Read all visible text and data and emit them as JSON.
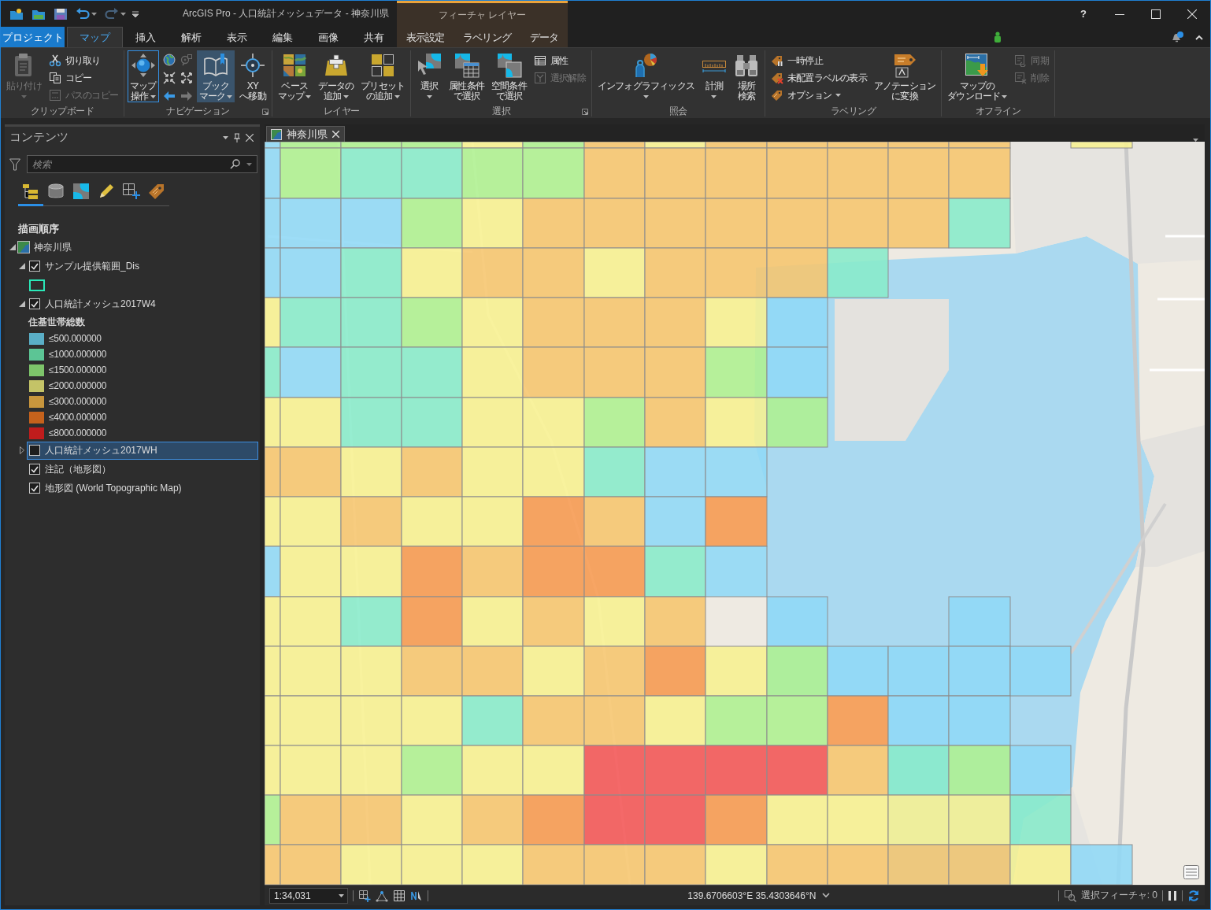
{
  "window": {
    "title": "ArcGIS Pro - 人口統計メッシュデータ - 神奈川県",
    "contextual_header": "フィーチャ レイヤー",
    "help": "?"
  },
  "quick_access": [
    {
      "dropdown": false,
      "disabled": false
    },
    {
      "dropdown": false,
      "disabled": false
    },
    {
      "dropdown": false,
      "disabled": false
    },
    {
      "dropdown": true,
      "disabled": false
    },
    {
      "dropdown": true,
      "disabled": true
    }
  ],
  "tabs": [
    {
      "label": "プロジェクト",
      "kind": "backstage",
      "selected": false
    },
    {
      "label": "マップ",
      "kind": "core",
      "selected": true
    },
    {
      "label": "挿入",
      "kind": "core",
      "selected": false
    },
    {
      "label": "解析",
      "kind": "core",
      "selected": false
    },
    {
      "label": "表示",
      "kind": "core",
      "selected": false
    },
    {
      "label": "編集",
      "kind": "core",
      "selected": false
    },
    {
      "label": "画像",
      "kind": "core",
      "selected": false
    },
    {
      "label": "共有",
      "kind": "core",
      "selected": false
    },
    {
      "label": "表示設定",
      "kind": "contextual",
      "selected": false
    },
    {
      "label": "ラベリング",
      "kind": "contextual",
      "selected": false
    },
    {
      "label": "データ",
      "kind": "contextual",
      "selected": false
    }
  ],
  "notifications": {
    "unread": true
  },
  "ribbon": {
    "groups": [
      {
        "label": "クリップボード",
        "launcher": false,
        "items": [
          {
            "kind": "large",
            "lines": [
              "貼り付け"
            ],
            "dropdown": true,
            "disabled": true,
            "active": false,
            "highlighted": false
          },
          {
            "kind": "stack",
            "items": [
              {
                "label": "切り取り",
                "disabled": false,
                "dropdown": false
              },
              {
                "label": "コピー",
                "disabled": false,
                "dropdown": false
              },
              {
                "label": "パスのコピー",
                "disabled": true,
                "dropdown": false
              }
            ]
          }
        ]
      },
      {
        "label": "ナビゲーション",
        "launcher": true,
        "items": [
          {
            "kind": "large",
            "lines": [
              "マップ",
              "操作"
            ],
            "dropdown": true,
            "disabled": false,
            "active": true,
            "highlighted": false
          },
          {
            "kind": "tools",
            "tools": [
              {
                "disabled": false
              },
              {
                "disabled": true
              },
              {
                "disabled": false
              },
              {
                "disabled": false
              },
              {
                "disabled": false
              },
              {
                "disabled": true
              }
            ]
          },
          {
            "kind": "large",
            "lines": [
              "ブック",
              "マーク"
            ],
            "dropdown": true,
            "disabled": false,
            "active": false,
            "highlighted": true
          },
          {
            "kind": "large",
            "lines": [
              "XY",
              "へ移動"
            ],
            "dropdown": false,
            "disabled": false,
            "active": false,
            "highlighted": false
          }
        ]
      },
      {
        "label": "レイヤー",
        "launcher": false,
        "items": [
          {
            "kind": "large",
            "lines": [
              "ベース",
              "マップ"
            ],
            "dropdown": true,
            "disabled": false,
            "active": false,
            "highlighted": false
          },
          {
            "kind": "large",
            "lines": [
              "データの",
              "追加"
            ],
            "dropdown": true,
            "disabled": false,
            "active": false,
            "highlighted": false
          },
          {
            "kind": "large",
            "lines": [
              "プリセット",
              "の追加"
            ],
            "dropdown": true,
            "disabled": false,
            "active": false,
            "highlighted": false
          }
        ]
      },
      {
        "label": "選択",
        "launcher": true,
        "items": [
          {
            "kind": "large",
            "lines": [
              "選択"
            ],
            "dropdown": true,
            "disabled": false,
            "active": false,
            "highlighted": false
          },
          {
            "kind": "large",
            "lines": [
              "属性条件",
              "で選択"
            ],
            "dropdown": false,
            "disabled": false,
            "active": false,
            "highlighted": false
          },
          {
            "kind": "large",
            "lines": [
              "空間条件",
              "で選択"
            ],
            "dropdown": false,
            "disabled": false,
            "active": false,
            "highlighted": false
          },
          {
            "kind": "stack",
            "items": [
              {
                "label": "属性",
                "disabled": false,
                "dropdown": false
              },
              {
                "label": "選択解除",
                "disabled": true,
                "dropdown": false
              }
            ]
          }
        ]
      },
      {
        "label": "照会",
        "launcher": false,
        "items": [
          {
            "kind": "large",
            "lines": [
              "インフォグラフィックス"
            ],
            "dropdown": true,
            "disabled": false,
            "active": false,
            "highlighted": false
          },
          {
            "kind": "large",
            "lines": [
              "計測"
            ],
            "dropdown": true,
            "disabled": false,
            "active": false,
            "highlighted": false
          },
          {
            "kind": "large",
            "lines": [
              "場所",
              "検索"
            ],
            "dropdown": false,
            "disabled": false,
            "active": false,
            "highlighted": false
          }
        ]
      },
      {
        "label": "ラベリング",
        "launcher": false,
        "items": [
          {
            "kind": "stack",
            "items": [
              {
                "label": "一時停止",
                "disabled": false,
                "dropdown": false
              },
              {
                "label": "未配置ラベルの表示",
                "disabled": false,
                "dropdown": false
              },
              {
                "label": "オプション",
                "disabled": false,
                "dropdown": true
              }
            ]
          },
          {
            "kind": "large",
            "lines": [
              "アノテーション",
              "に変換"
            ],
            "dropdown": false,
            "disabled": false,
            "active": false,
            "highlighted": false
          }
        ]
      },
      {
        "label": "オフライン",
        "launcher": false,
        "items": [
          {
            "kind": "large",
            "lines": [
              "マップの",
              "ダウンロード"
            ],
            "dropdown": true,
            "disabled": false,
            "active": false,
            "highlighted": false
          },
          {
            "kind": "stack",
            "items": [
              {
                "label": "同期",
                "disabled": true,
                "dropdown": false
              },
              {
                "label": "削除",
                "disabled": true,
                "dropdown": false
              }
            ]
          }
        ]
      }
    ]
  },
  "contents": {
    "title": "コンテンツ",
    "search": {
      "placeholder": "検索"
    },
    "views": [
      {
        "selected": true
      },
      {
        "selected": false
      },
      {
        "selected": false
      },
      {
        "selected": false
      },
      {
        "selected": false
      },
      {
        "selected": false
      }
    ],
    "heading": "描画順序",
    "tree": {
      "label": "神奈川県",
      "expanded": true,
      "children": [
        {
          "label": "サンプル提供範囲_Dis",
          "kind": "layer",
          "checked": true,
          "expanded": true,
          "selected": false,
          "legend": {
            "classes": [
              {
                "kind": "outline",
                "color": "#2ae8b8"
              }
            ]
          }
        },
        {
          "label": "人口統計メッシュ2017W4",
          "kind": "layer",
          "checked": true,
          "expanded": true,
          "selected": false,
          "legend": {
            "title": "住基世帯総数",
            "classes": [
              {
                "kind": "fill",
                "label": "≤500.000000",
                "color": "#5aaec6"
              },
              {
                "kind": "fill",
                "label": "≤1000.000000",
                "color": "#5cc595"
              },
              {
                "kind": "fill",
                "label": "≤1500.000000",
                "color": "#7dc46a"
              },
              {
                "kind": "fill",
                "label": "≤2000.000000",
                "color": "#c4c367"
              },
              {
                "kind": "fill",
                "label": "≤3000.000000",
                "color": "#c8963d"
              },
              {
                "kind": "fill",
                "label": "≤4000.000000",
                "color": "#c5621c"
              },
              {
                "kind": "fill",
                "label": "≤8000.000000",
                "color": "#c01c1c"
              }
            ]
          }
        },
        {
          "label": "人口統計メッシュ2017WH",
          "kind": "layer",
          "checked": false,
          "expanded": false,
          "selected": true
        },
        {
          "label": "注記（地形図）",
          "kind": "basemap",
          "checked": true,
          "selected": false
        },
        {
          "label": "地形図 (World Topographic Map)",
          "kind": "basemap",
          "checked": true,
          "selected": false
        }
      ]
    }
  },
  "map_view": {
    "tabs": [
      {
        "label": "神奈川県",
        "selected": true
      }
    ]
  },
  "status_bar": {
    "scale": "1:34,031",
    "coordinates": "139.6706603°E 35.4303646°N",
    "selection": "選択フィーチャ: 0"
  }
}
